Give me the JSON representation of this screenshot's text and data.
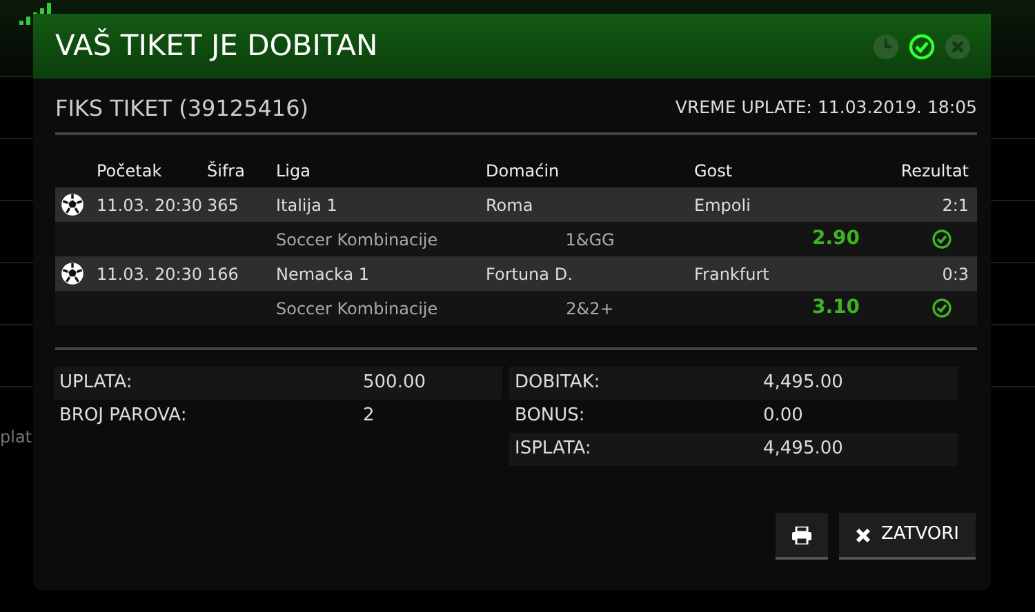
{
  "background": {
    "text": "plat"
  },
  "modal": {
    "title": "VAŠ TIKET JE DOBITAN",
    "status_icons": [
      {
        "kind": "pending",
        "active": false
      },
      {
        "kind": "won",
        "active": true
      },
      {
        "kind": "lost",
        "active": false
      }
    ],
    "ticket_title": "FIKS TIKET (39125416)",
    "paid_time": "VREME UPLATE: 11.03.2019. 18:05",
    "table": {
      "columns": [
        "Početak",
        "Šifra",
        "Liga",
        "Domaćin",
        "Gost",
        "Rezultat"
      ],
      "rows": [
        {
          "start": "11.03. 20:30",
          "code": "365",
          "league": "Italija 1",
          "home": "Roma",
          "away": "Empoli",
          "result": "2:1",
          "bet_type": "Soccer Kombinacije",
          "pick": "1&GG",
          "odds": "2.90",
          "won": true
        },
        {
          "start": "11.03. 20:30",
          "code": "166",
          "league": "Nemacka 1",
          "home": "Fortuna D.",
          "away": "Frankfurt",
          "result": "0:3",
          "bet_type": "Soccer Kombinacije",
          "pick": "2&2+",
          "odds": "3.10",
          "won": true
        }
      ]
    },
    "summary_left": [
      {
        "label": "UPLATA:",
        "value": "500.00"
      },
      {
        "label": "BROJ PAROVA:",
        "value": "2"
      }
    ],
    "summary_right": [
      {
        "label": "DOBITAK:",
        "value": "4,495.00"
      },
      {
        "label": "BONUS:",
        "value": "0.00"
      },
      {
        "label": "ISPLATA:",
        "value": "4,495.00"
      }
    ],
    "close_button": "ZATVORI"
  }
}
